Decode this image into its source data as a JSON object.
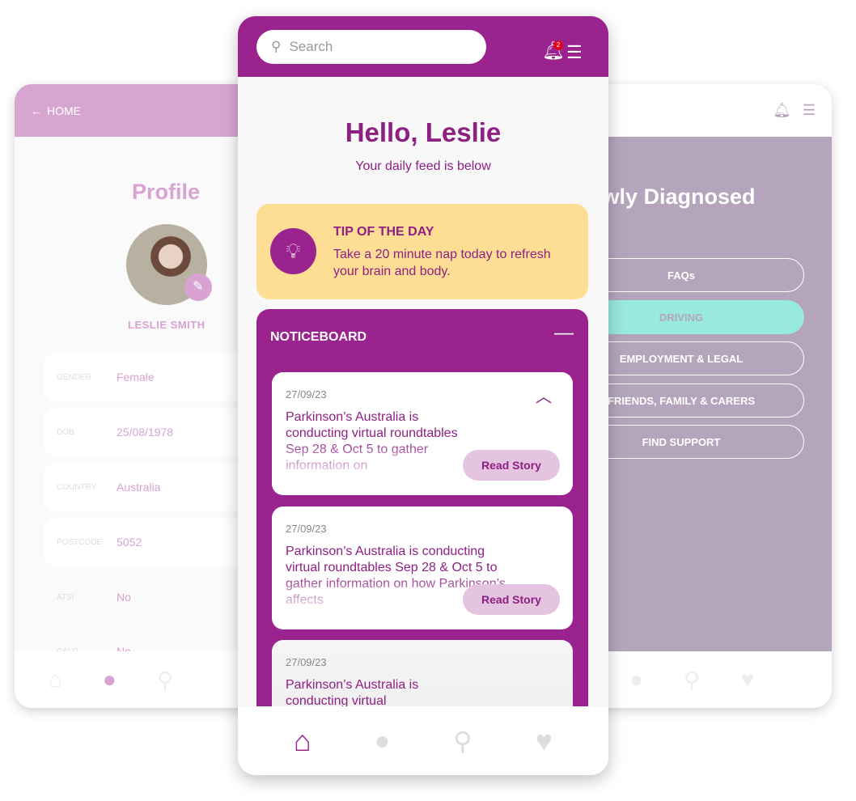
{
  "profile": {
    "back": "HOME",
    "title": "Profile",
    "name": "LESLIE SMITH",
    "fields": [
      {
        "k": "GENDER",
        "v": "Female"
      },
      {
        "k": "DOB",
        "v": "25/08/1978"
      },
      {
        "k": "COUNTRY",
        "v": "Australia"
      },
      {
        "k": "POSTCODE",
        "v": "5052"
      },
      {
        "k": "ATSI",
        "v": "No"
      },
      {
        "k": "CALD",
        "v": "No"
      }
    ]
  },
  "diagnosed": {
    "title": "Newly Diagnosed",
    "buttons": [
      "FAQs",
      "DRIVING",
      "EMPLOYMENT & LEGAL",
      "FRIENDS, FAMILY & CARERS",
      "FIND SUPPORT"
    ],
    "active": "DRIVING"
  },
  "home": {
    "search_placeholder": "Search",
    "notif_count": "2",
    "greeting": "Hello, Leslie",
    "subtitle": "Your daily feed is below",
    "tip": {
      "title": "TIP OF THE DAY",
      "body": "Take a 20 minute nap today to refresh your brain and body."
    },
    "noticeboard": {
      "title": "NOTICEBOARD",
      "items": [
        {
          "date": "27/09/23",
          "text": "Parkinson’s Australia is conducting virtual roundtables Sep 28 & Oct 5 to gather information on",
          "button": "Read Story"
        },
        {
          "date": "27/09/23",
          "text": "Parkinson’s Australia is conducting virtual roundtables Sep 28 & Oct 5 to gather information on how Parkinson’s affects",
          "button": "Read Story"
        },
        {
          "date": "27/09/23",
          "text": "Parkinson’s Australia is conducting virtual"
        }
      ]
    }
  },
  "colors": {
    "primary": "#9b238f",
    "tip_bg": "#fedd94",
    "active_button": "#98e9df"
  }
}
